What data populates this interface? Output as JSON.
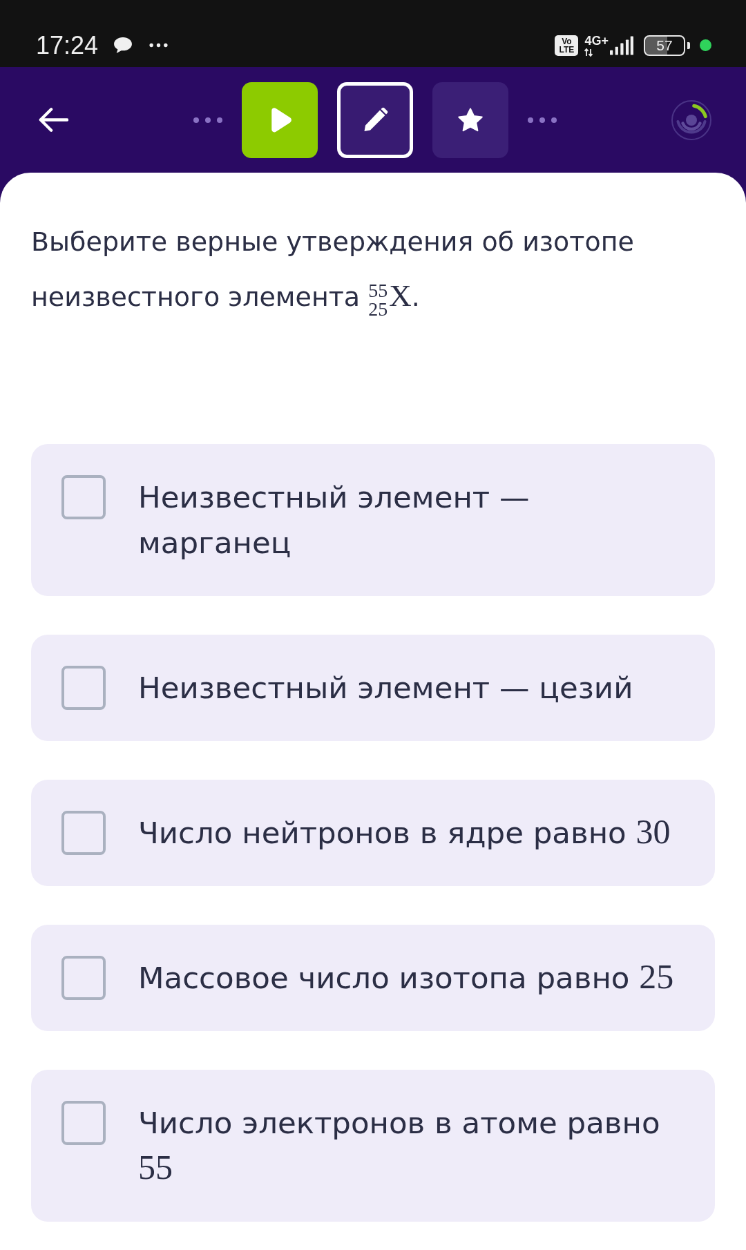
{
  "status_bar": {
    "time": "17:24",
    "volte": {
      "top": "Vo",
      "bottom": "LTE"
    },
    "network": "4G+",
    "battery": "57"
  },
  "header": {
    "steps": [
      {
        "kind": "video",
        "completed": true,
        "selected": false
      },
      {
        "kind": "task",
        "completed": false,
        "selected": true
      },
      {
        "kind": "bonus",
        "completed": false,
        "selected": false
      }
    ],
    "progress": {
      "level": 0.18
    }
  },
  "question": {
    "text": "Выберите верные утверждения об изотопе неизвестного элемента",
    "isotope": {
      "mass_number": "55",
      "atomic_number": "25",
      "symbol": "X"
    },
    "end": "."
  },
  "options": [
    {
      "text": "Неизвестный элемент — марганец",
      "checked": false
    },
    {
      "text": "Неизвестный элемент — цезий",
      "checked": false
    },
    {
      "text": "Число нейтронов в ядре равно",
      "math": "30",
      "checked": false
    },
    {
      "text": "Массовое число изотопа равно",
      "math": "25",
      "checked": false
    },
    {
      "text": "Число электронов в атоме равно",
      "math": "55",
      "checked": false
    }
  ]
}
